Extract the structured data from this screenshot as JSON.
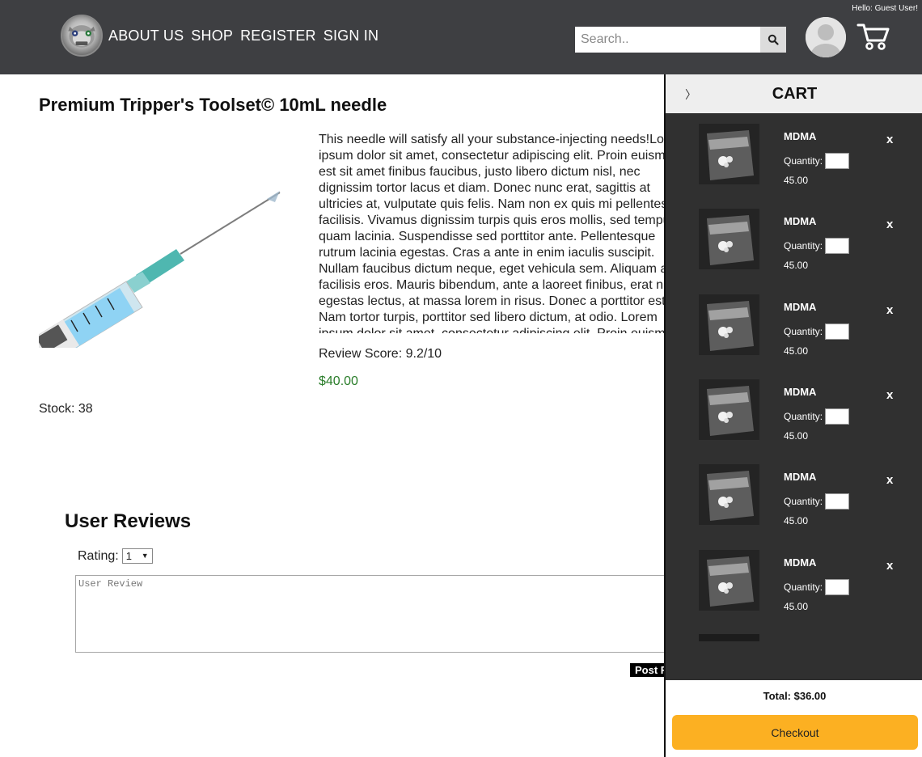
{
  "header": {
    "greeting": "Hello: Guest User!",
    "nav": [
      "ABOUT US",
      "SHOP",
      "REGISTER",
      "SIGN IN"
    ],
    "search": {
      "placeholder": "Search.."
    },
    "icons": {
      "search": "search-icon",
      "avatar": "user-avatar-icon",
      "cart": "shopping-cart-icon",
      "logo": "site-logo"
    }
  },
  "product": {
    "title": "Premium Tripper's Toolset© 10mL needle",
    "description": "This needle will satisfy all your substance-injecting needs!Lorem ipsum dolor sit amet, consectetur adipiscing elit. Proin euismod, est sit amet finibus faucibus, justo libero dictum nisl, nec dignissim tortor lacus et diam. Donec nunc erat, sagittis at ultricies at, vulputate quis felis. Nam non ex quis mi pellentesque facilisis. Vivamus dignissim turpis quis eros mollis, sed tempus quam lacinia. Suspendisse sed porttitor ante. Pellentesque rutrum lacinia egestas. Cras a ante in enim iaculis suscipit. Nullam faucibus dictum neque, eget vehicula sem. Aliquam ac facilisis eros. Mauris bibendum, ante a laoreet finibus, erat nibh egestas lectus, at massa lorem in risus. Donec a porttitor est. Nam tortor turpis, porttitor sed libero dictum, at odio. Lorem ipsum dolor sit amet, consectetur adipiscing elit. Proin euismod, est sit amet finibus faucibus, justo libero dictum nisl, nec dignissim tortor lacus et diam. Donec nunc erat, sagittis at ultricies at, vulputate quis felis. Nam non ex quis mi pellentesque facilisis. Vivamus dignissim turpis quis eros mollis, sed tempus quam lacinia. Suspendisse sed porttitor ante. Pellentesque rutrum lacinia egestas. Cras a ante in enim iaculis suscipit.",
    "review_score": "Review Score: 9.2/10",
    "price": "$40.00",
    "stock": "Stock: 38",
    "price_color": "#2a7d2a"
  },
  "reviews": {
    "title": "User Reviews",
    "rating_label": "Rating:",
    "rating_value": "1",
    "review_placeholder": "User Review",
    "post_label": "Post R"
  },
  "cart": {
    "collapse_label": "〉",
    "title": "CART",
    "items": [
      {
        "name": "MDMA",
        "quantity_label": "Quantity:",
        "price": "45.00",
        "remove": "x"
      },
      {
        "name": "MDMA",
        "quantity_label": "Quantity:",
        "price": "45.00",
        "remove": "x"
      },
      {
        "name": "MDMA",
        "quantity_label": "Quantity:",
        "price": "45.00",
        "remove": "x"
      },
      {
        "name": "MDMA",
        "quantity_label": "Quantity:",
        "price": "45.00",
        "remove": "x"
      },
      {
        "name": "MDMA",
        "quantity_label": "Quantity:",
        "price": "45.00",
        "remove": "x"
      },
      {
        "name": "MDMA",
        "quantity_label": "Quantity:",
        "price": "45.00",
        "remove": "x"
      }
    ],
    "total": "Total: $36.00",
    "checkout_label": "Checkout",
    "checkout_color": "#fcb022"
  },
  "colors": {
    "header_bg": "#3e3f42",
    "cart_list_bg": "#303030"
  }
}
